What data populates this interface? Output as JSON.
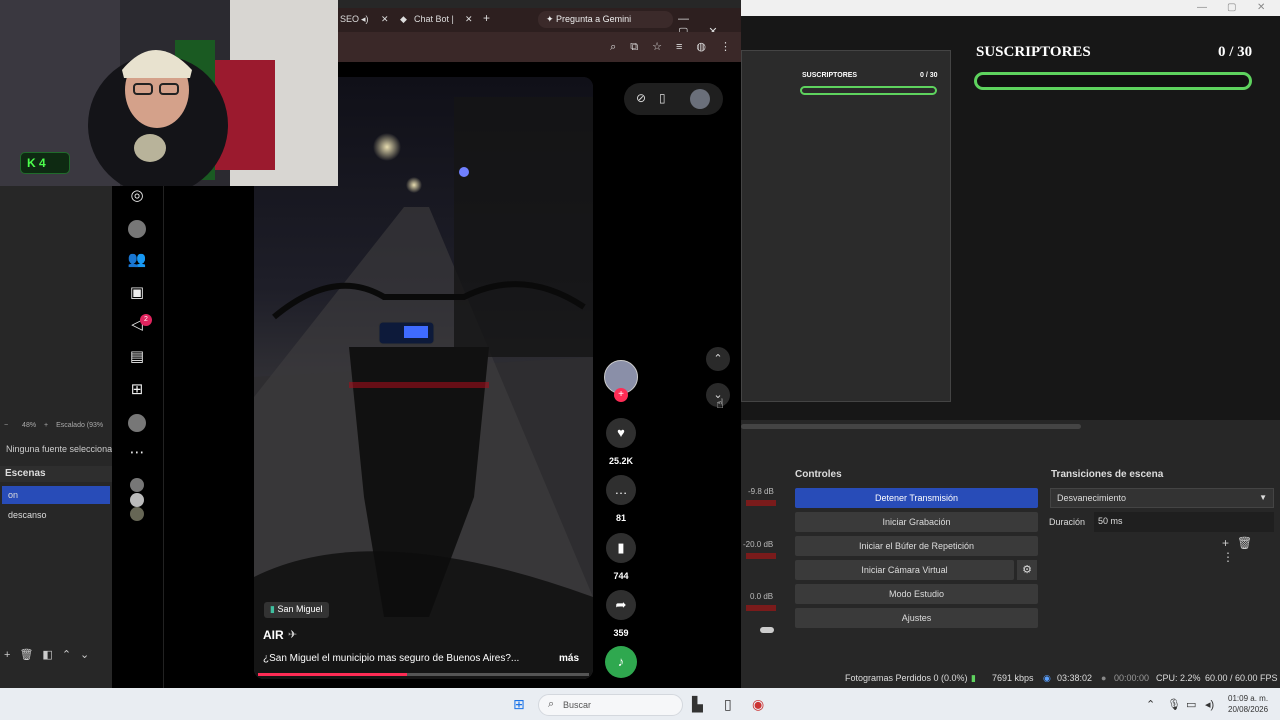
{
  "obs": {
    "preview": {
      "subs_title": "SUSCRIPTORES",
      "subs_count": "0 / 30"
    },
    "mini_preview": {
      "subs_title": "SUSCRIPTORES",
      "subs_count": "0 / 30"
    },
    "left_info": {
      "zoom": "48%",
      "scale": "Escalado (93%"
    },
    "no_source": "Ninguna fuente selecciona",
    "scenes": {
      "title": "Escenas",
      "items": [
        {
          "label": "on",
          "active": true
        },
        {
          "label": "descanso",
          "active": false
        }
      ]
    },
    "audio": {
      "db": [
        "-9.8 dB",
        "-20.0 dB",
        "0.0 dB"
      ]
    },
    "controls": {
      "title": "Controles",
      "stop_stream": "Detener Transmisión",
      "start_recording": "Iniciar Grabación",
      "replay_buffer": "Iniciar el Búfer de Repetición",
      "virtual_cam": "Iniciar Cámara Virtual",
      "studio_mode": "Modo Estudio",
      "settings": "Ajustes"
    },
    "transitions": {
      "title": "Transiciones de escena",
      "selected": "Desvanecimiento",
      "duration_label": "Duración",
      "duration_value": "50 ms"
    },
    "status": {
      "dropped": "Fotogramas Perdidos 0 (0.0%)",
      "bitrate": "7691 kbps",
      "stream_time": "03:38:02",
      "rec_time": "00:00:00",
      "cpu": "CPU: 2.2%",
      "fps": "60.00 / 60.00 FPS"
    }
  },
  "browser": {
    "tabs": [
      {
        "label": "SEO"
      },
      {
        "label": "Chat Bot |"
      }
    ],
    "gemini_button": "Pregunta a Gemini",
    "tiktok": {
      "location": "San Miguel",
      "author": "AIR",
      "caption": "¿San Miguel el municipio mas seguro de Buenos Aires?...",
      "more": "más",
      "likes": "25.2K",
      "comments": "81",
      "saves": "744",
      "shares": "359",
      "notifications_badge": "2",
      "progress_fraction": 0.45
    }
  },
  "webcam": {
    "badge": "K 4"
  },
  "taskbar": {
    "search_placeholder": "Buscar",
    "time": "01:09 a. m.",
    "date": "20/08/2026"
  },
  "colors": {
    "accent_blue": "#284cb8",
    "subs_green": "#5ed35e",
    "tiktok_red": "#fe2c55"
  }
}
